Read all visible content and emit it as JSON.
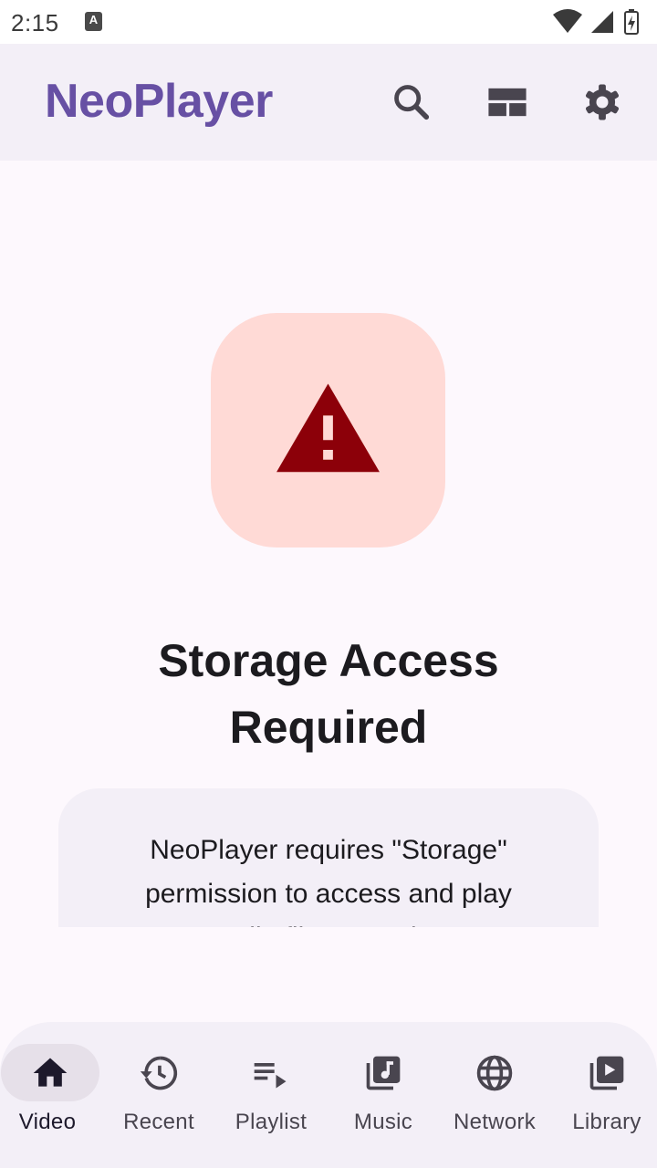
{
  "status_bar": {
    "time": "2:15",
    "notification_badge": "A",
    "icons": [
      "wifi-icon",
      "cellular-signal-icon",
      "battery-icon"
    ]
  },
  "app_bar": {
    "title": "NeoPlayer",
    "actions": [
      "search-icon",
      "view-layout-icon",
      "settings-gear-icon"
    ]
  },
  "permission": {
    "icon": "warning-icon",
    "heading_line1": "Storage Access",
    "heading_line2": "Required",
    "message_line1": "NeoPlayer requires \"Storage\"",
    "message_line2": "permission to access and play",
    "message_line3": "media files stored on"
  },
  "bottom_nav": {
    "selected": "Video",
    "items": [
      {
        "label": "Video",
        "icon": "home-icon"
      },
      {
        "label": "Recent",
        "icon": "history-icon"
      },
      {
        "label": "Playlist",
        "icon": "playlist-play-icon"
      },
      {
        "label": "Music",
        "icon": "music-library-icon"
      },
      {
        "label": "Network",
        "icon": "globe-icon"
      },
      {
        "label": "Library",
        "icon": "video-library-icon"
      }
    ]
  },
  "colors": {
    "brand": "#6750a4",
    "warning_bg": "#ffdad6",
    "warning_icon": "#8c0009",
    "surface": "#f3eff7",
    "nav_indicator": "#e6e0e9"
  }
}
